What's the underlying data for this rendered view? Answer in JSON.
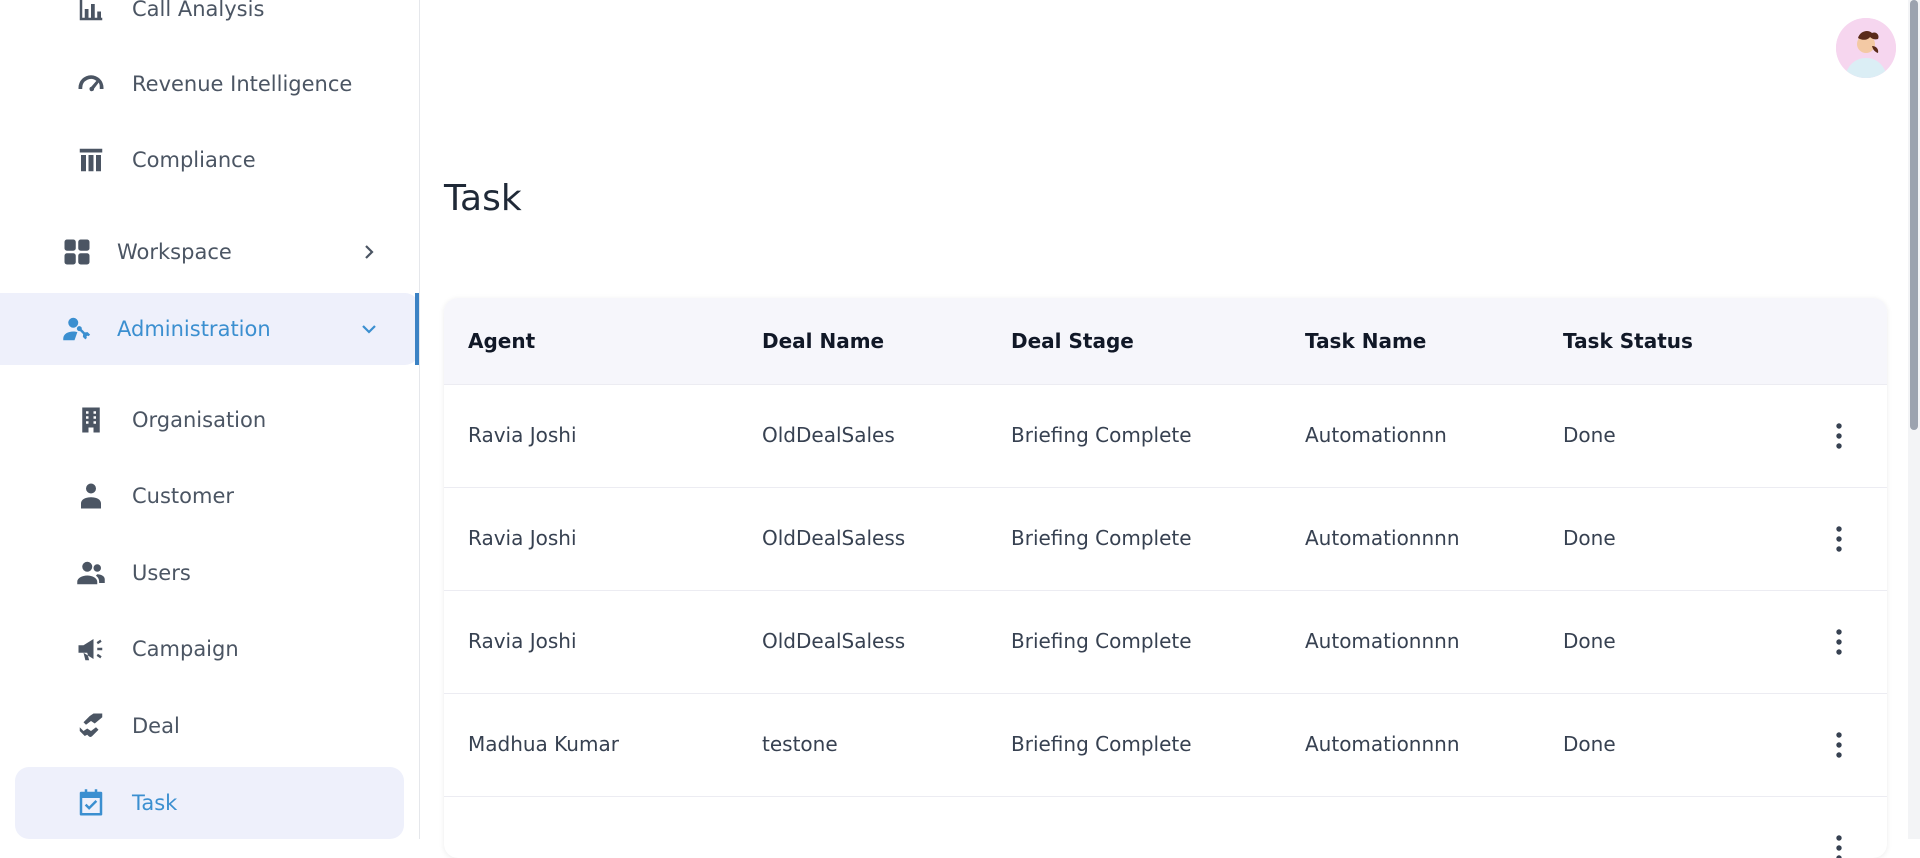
{
  "sidebar": {
    "items": [
      {
        "label": "Call Analysis"
      },
      {
        "label": "Revenue Intelligence"
      },
      {
        "label": "Compliance"
      },
      {
        "label": "Workspace"
      },
      {
        "label": "Administration"
      },
      {
        "label": "Organisation"
      },
      {
        "label": "Customer"
      },
      {
        "label": "Users"
      },
      {
        "label": "Campaign"
      },
      {
        "label": "Deal"
      },
      {
        "label": "Task"
      }
    ]
  },
  "page": {
    "title": "Task"
  },
  "table": {
    "headers": [
      "Agent",
      "Deal Name",
      "Deal Stage",
      "Task Name",
      "Task Status"
    ],
    "rows": [
      [
        "Ravia Joshi",
        "OldDealSales",
        "Briefing Complete",
        "Automationnn",
        "Done"
      ],
      [
        "Ravia Joshi",
        "OldDealSaless",
        "Briefing Complete",
        "Automationnnn",
        "Done"
      ],
      [
        "Ravia Joshi",
        "OldDealSaless",
        "Briefing Complete",
        "Automationnnn",
        "Done"
      ],
      [
        "Madhua Kumar",
        "testone",
        "Briefing Complete",
        "Automationnnn",
        "Done"
      ]
    ]
  },
  "colors": {
    "accent": "#3b8fd0",
    "active_bg": "#eef0fb",
    "header_bg": "#f6f6fb"
  },
  "icons": {
    "call_analysis": "bar-chart-icon",
    "revenue": "gauge-icon",
    "compliance": "columns-icon",
    "workspace": "grid-icon",
    "administration": "user-wrench-icon",
    "organisation": "building-icon",
    "customer": "person-tie-icon",
    "users": "people-icon",
    "campaign": "megaphone-icon",
    "deal": "handshake-icon",
    "task": "calendar-check-icon",
    "row_menu": "more-vertical-icon"
  }
}
